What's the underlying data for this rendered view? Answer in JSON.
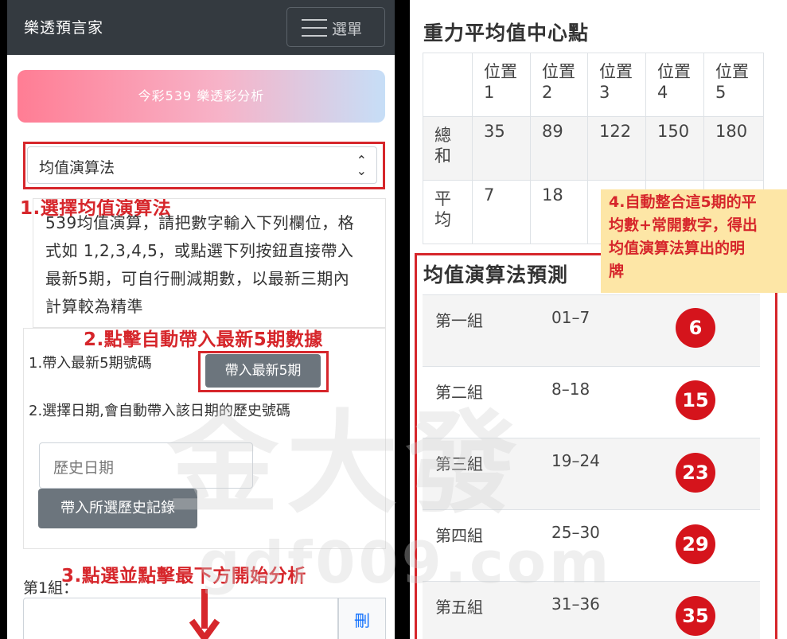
{
  "left": {
    "navbar": {
      "brand": "樂透預言家",
      "menu_label": "選單"
    },
    "banner": "今彩539 樂透彩分析",
    "algorithm_select": {
      "value": "均值演算法",
      "chevron_up": "⌃",
      "chevron_down": "⌄"
    },
    "annotations": {
      "step1": "1.選擇均值演算法",
      "step2": "2.點擊自動帶入最新5期數據",
      "step3": "3.點選並點擊最下方開始分析"
    },
    "intro": "539均值演算，請把數字輸入下列欄位，格式如 1,2,3,4,5，或點選下列按鈕直接帶入最新5期，可自行刪減期數，以最新三期內計算較為精準",
    "option1": {
      "label": "1.帶入最新5期號碼",
      "button": "帶入最新5期"
    },
    "option2": {
      "label": "2.選擇日期,會自動帶入該日期的歷史號碼",
      "date_placeholder": "歷史日期",
      "button": "帶入所選歷史記錄"
    },
    "group1": {
      "label": "第1組：",
      "delete": "刪"
    }
  },
  "right": {
    "gravity": {
      "title": "重力平均值中心點",
      "columns": [
        "位置1",
        "位置2",
        "位置3",
        "位置4",
        "位置5"
      ],
      "rows": [
        {
          "label": "總和",
          "values": [
            "35",
            "89",
            "122",
            "150",
            "180"
          ]
        },
        {
          "label": "平均",
          "values": [
            "7",
            "18",
            "",
            "",
            ""
          ]
        }
      ]
    },
    "prediction": {
      "title": "均值演算法預測",
      "rows": [
        {
          "group": "第一組",
          "range": "01–7",
          "number": "6"
        },
        {
          "group": "第二組",
          "range": "8–18",
          "number": "15"
        },
        {
          "group": "第三組",
          "range": "19–24",
          "number": "23"
        },
        {
          "group": "第四組",
          "range": "25–30",
          "number": "29"
        },
        {
          "group": "第五組",
          "range": "31–36",
          "number": "35"
        }
      ]
    },
    "annotation4": [
      "4.自動整合這5期的平",
      "均數+常開數字，得出",
      "均值演算法算出的明",
      "牌"
    ]
  },
  "watermark": {
    "main": "金大發",
    "url": "gdf009.com"
  },
  "colors": {
    "annotation_red": "#d6262b",
    "ball_red": "#d5141c",
    "navbar": "#343a40",
    "button_gray": "#6c757d",
    "note_yellow": "#fde6a6"
  }
}
